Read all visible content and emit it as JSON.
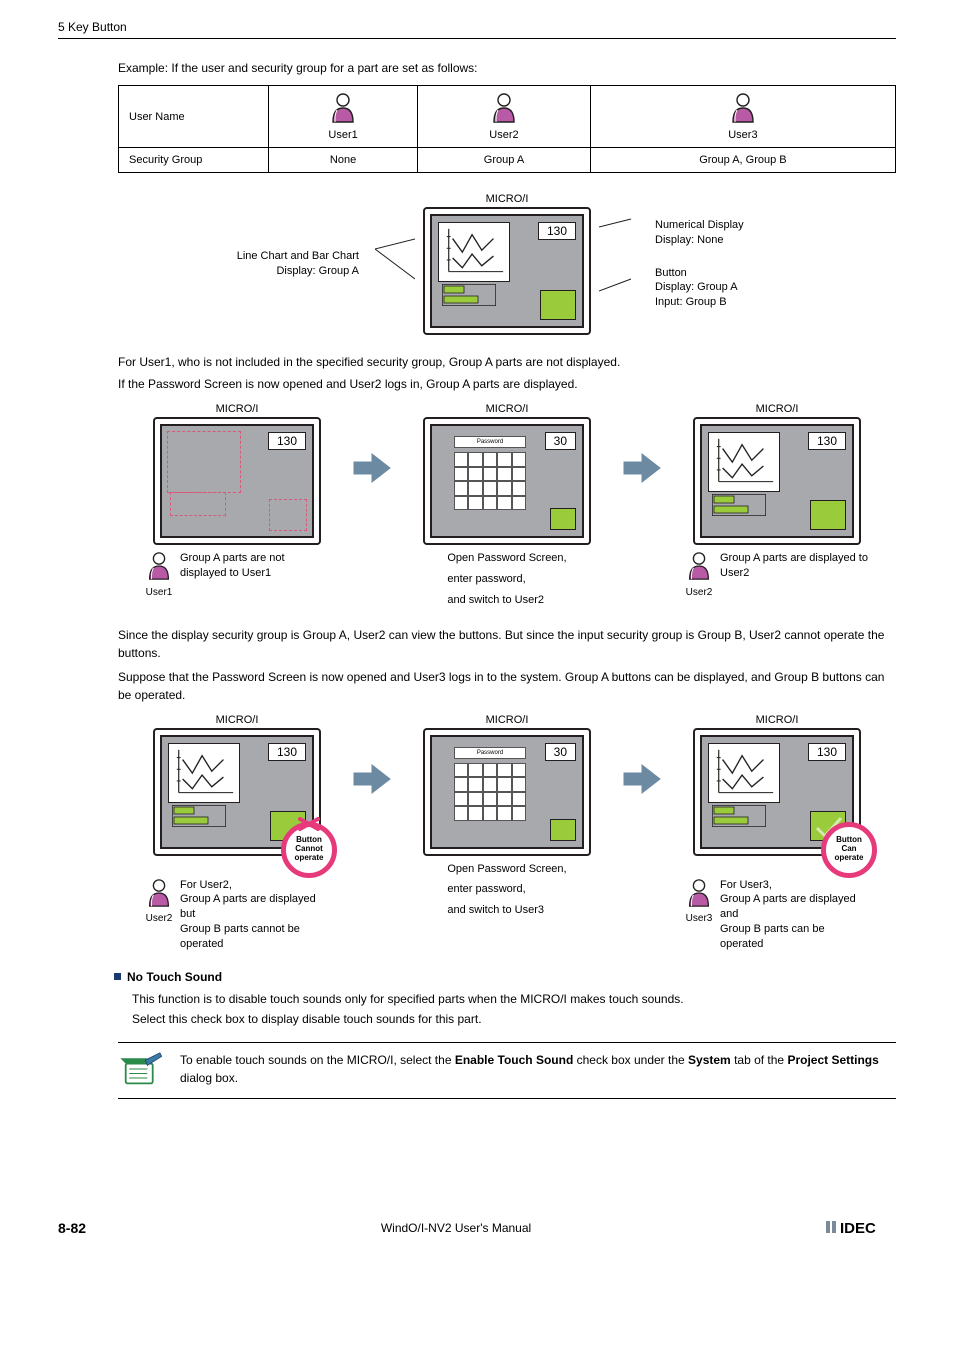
{
  "header": {
    "title": "5 Key Button"
  },
  "example_intro": "Example: If the user and security group for a part are set as follows:",
  "table": {
    "row1_label": "User Name",
    "row2_label": "Security Group",
    "users": [
      {
        "name": "User1",
        "group": "None"
      },
      {
        "name": "User2",
        "group": "Group A"
      },
      {
        "name": "User3",
        "group": "Group A, Group B"
      }
    ]
  },
  "diagram1": {
    "micro_label": "MICRO/I",
    "left_annot_line1": "Line Chart and Bar Chart",
    "left_annot_line2": "Display: Group A",
    "right_annot1_line1": "Numerical Display",
    "right_annot1_line2": "Display: None",
    "right_annot2_line1": "Button",
    "right_annot2_line2": "Display: Group A",
    "right_annot2_line3": "Input: Group B",
    "num": "130"
  },
  "para1_line1": "For User1, who is not included in the specified security group, Group A parts are not displayed.",
  "para1_line2": "If the Password Screen is now opened and User2 logs in, Group A parts are displayed.",
  "scenario1": {
    "micro": "MICRO/I",
    "c1_num": "130",
    "c1_user": "User1",
    "c1_cap": "Group A parts are not displayed to User1",
    "c2_num": "30",
    "c2_cap_l1": "Open Password Screen,",
    "c2_cap_l2": "enter password,",
    "c2_cap_l3": "and switch to User2",
    "c3_num": "130",
    "c3_user": "User2",
    "c3_cap": "Group A parts are displayed to User2",
    "pw_label": "Password"
  },
  "para2_line1": "Since the display security group is Group A, User2 can view the buttons. But since the input security group is Group B, User2 cannot operate the buttons.",
  "para2_line2": "Suppose that the Password Screen is now opened and User3 logs in to the system. Group A buttons can be displayed, and Group B buttons can be operated.",
  "scenario2": {
    "micro": "MICRO/I",
    "c1_num": "130",
    "c1_user": "User2",
    "c1_cap_l1": "For User2,",
    "c1_cap_l2": "Group A parts are displayed but",
    "c1_cap_l3": "Group B parts cannot be operated",
    "c1_badge_l1": "Button",
    "c1_badge_l2": "Cannot operate",
    "c2_num": "30",
    "c2_cap_l1": "Open Password Screen,",
    "c2_cap_l2": "enter password,",
    "c2_cap_l3": "and switch to User3",
    "c3_num": "130",
    "c3_user": "User3",
    "c3_cap_l1": "For User3,",
    "c3_cap_l2": "Group A parts are displayed and",
    "c3_cap_l3": "Group B parts can be operated",
    "c3_badge_l1": "Button",
    "c3_badge_l2": "Can operate",
    "pw_label": "Password"
  },
  "notouch_heading": "No Touch Sound",
  "notouch_p1": "This function is to disable touch sounds only for specified parts when the MICRO/I makes touch sounds.",
  "notouch_p2": "Select this check box to display disable touch sounds for this part.",
  "note": {
    "pre": "To enable touch sounds on the MICRO/I, select the ",
    "b1": "Enable Touch Sound",
    "mid1": " check box under the ",
    "b2": "System",
    "mid2": " tab of the ",
    "b3": "Project Settings",
    "post": " dialog box."
  },
  "footer": {
    "page": "8-82",
    "center": "WindO/I-NV2 User's Manual",
    "brand": "IDEC"
  }
}
